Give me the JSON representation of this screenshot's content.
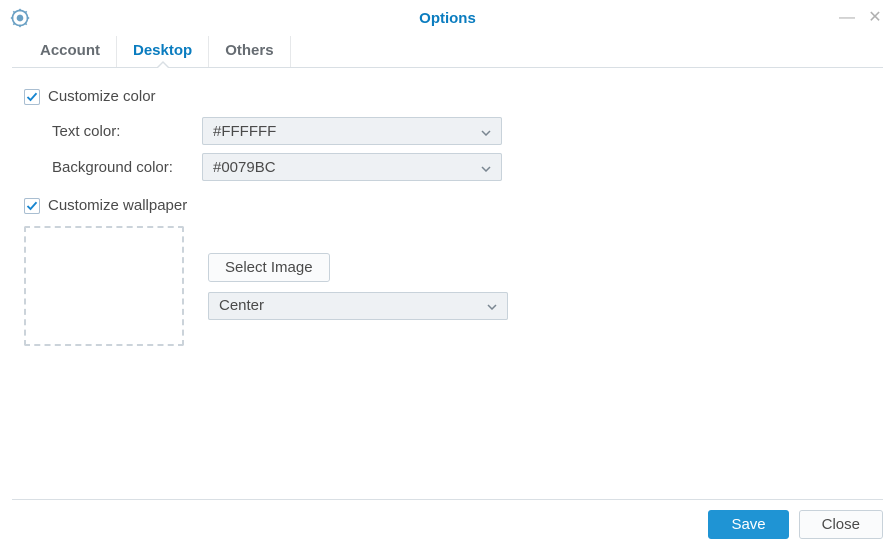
{
  "window": {
    "title": "Options"
  },
  "tabs": {
    "account": "Account",
    "desktop": "Desktop",
    "others": "Others"
  },
  "desktop": {
    "customize_color_label": "Customize color",
    "text_color_label": "Text color:",
    "text_color_value": "#FFFFFF",
    "bg_color_label": "Background color:",
    "bg_color_value": "#0079BC",
    "customize_wallpaper_label": "Customize wallpaper",
    "select_image_label": "Select Image",
    "position_value": "Center"
  },
  "footer": {
    "save": "Save",
    "close": "Close"
  }
}
